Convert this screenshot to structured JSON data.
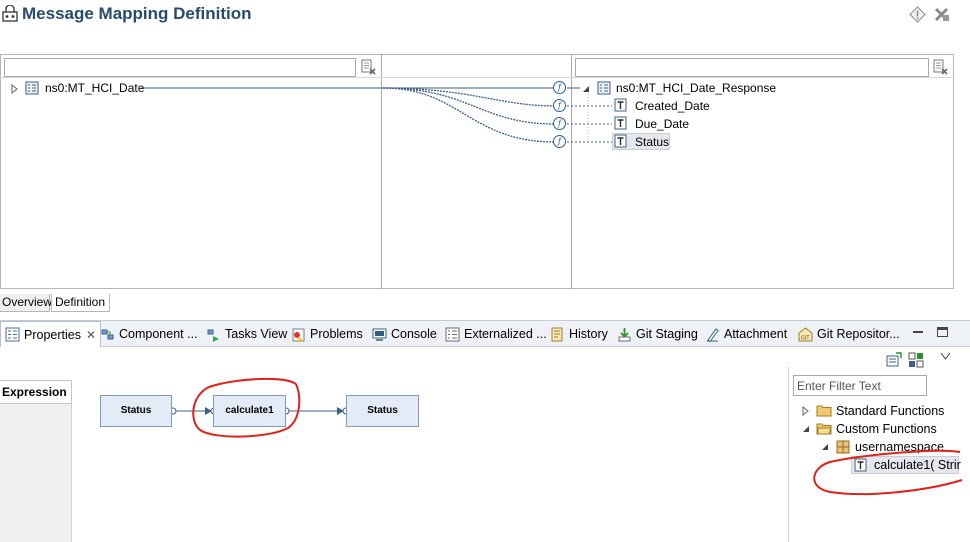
{
  "editor": {
    "title": "Message Mapping Definition",
    "tabs": [
      {
        "label": "Overview",
        "active": false
      },
      {
        "label": "Definition",
        "active": true
      }
    ]
  },
  "mapping": {
    "source_filter": {
      "value": "",
      "placeholder": ""
    },
    "target_filter": {
      "value": "",
      "placeholder": ""
    },
    "source_root": "ns0:MT_HCI_Date",
    "target_root": "ns0:MT_HCI_Date_Response",
    "target_fields": [
      {
        "label": "Created_Date"
      },
      {
        "label": "Due_Date"
      },
      {
        "label": "Status",
        "selected": true
      }
    ]
  },
  "views": {
    "tabs": [
      {
        "label": "Properties",
        "icon": "properties-icon",
        "active": true
      },
      {
        "label": "Component ...",
        "icon": "component-icon"
      },
      {
        "label": "Tasks View",
        "icon": "tasks-icon"
      },
      {
        "label": "Problems",
        "icon": "problems-icon"
      },
      {
        "label": "Console",
        "icon": "console-icon"
      },
      {
        "label": "Externalized ...",
        "icon": "externalized-icon"
      },
      {
        "label": "History",
        "icon": "history-icon"
      },
      {
        "label": "Git Staging",
        "icon": "git-staging-icon"
      },
      {
        "label": "Attachment",
        "icon": "attachment-icon"
      },
      {
        "label": "Git Repositor...",
        "icon": "git-repository-icon"
      }
    ]
  },
  "properties": {
    "side_tab": "Expression",
    "expression": {
      "source_node": "Status",
      "function_node": "calculate1",
      "target_node": "Status"
    }
  },
  "functions": {
    "filter": {
      "value": "Enter Filter Text"
    },
    "tree": {
      "standard": "Standard Functions",
      "custom": "Custom Functions",
      "namespace": "usernamespace",
      "function": "calculate1( Strir"
    }
  },
  "colors": {
    "title": "#274b6d",
    "annotation": "#e0201a",
    "node_fill": "#e3ecf6",
    "node_border": "#7f9db9"
  }
}
